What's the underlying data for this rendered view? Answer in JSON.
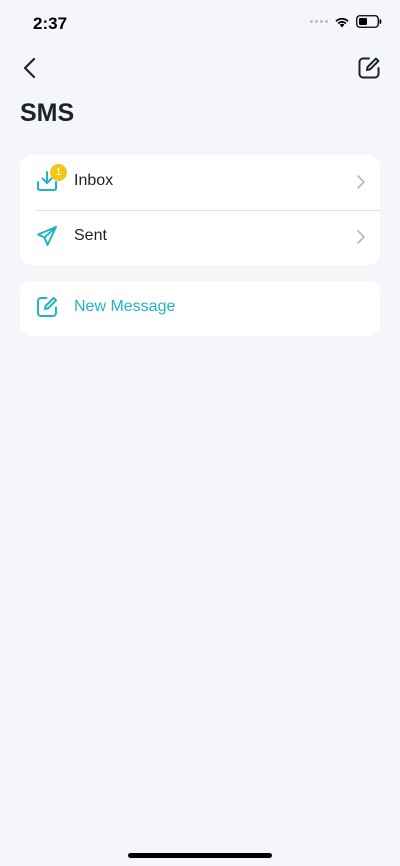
{
  "status_bar": {
    "time": "2:37",
    "icons": [
      "cellular-dots-icon",
      "wifi-icon",
      "battery-icon"
    ]
  },
  "nav": {
    "back_icon": "chevron-left-icon",
    "compose_icon": "compose-icon"
  },
  "page": {
    "title": "SMS"
  },
  "menu": {
    "items": [
      {
        "label": "Inbox",
        "icon": "inbox-download-icon",
        "badge": "1"
      },
      {
        "label": "Sent",
        "icon": "paper-plane-icon"
      }
    ]
  },
  "actions": {
    "new_message_label": "New Message",
    "new_message_icon": "compose-icon"
  },
  "colors": {
    "accent": "#1fb5c6",
    "badge": "#f5c518",
    "background": "#f5f6fa",
    "card": "#ffffff"
  }
}
